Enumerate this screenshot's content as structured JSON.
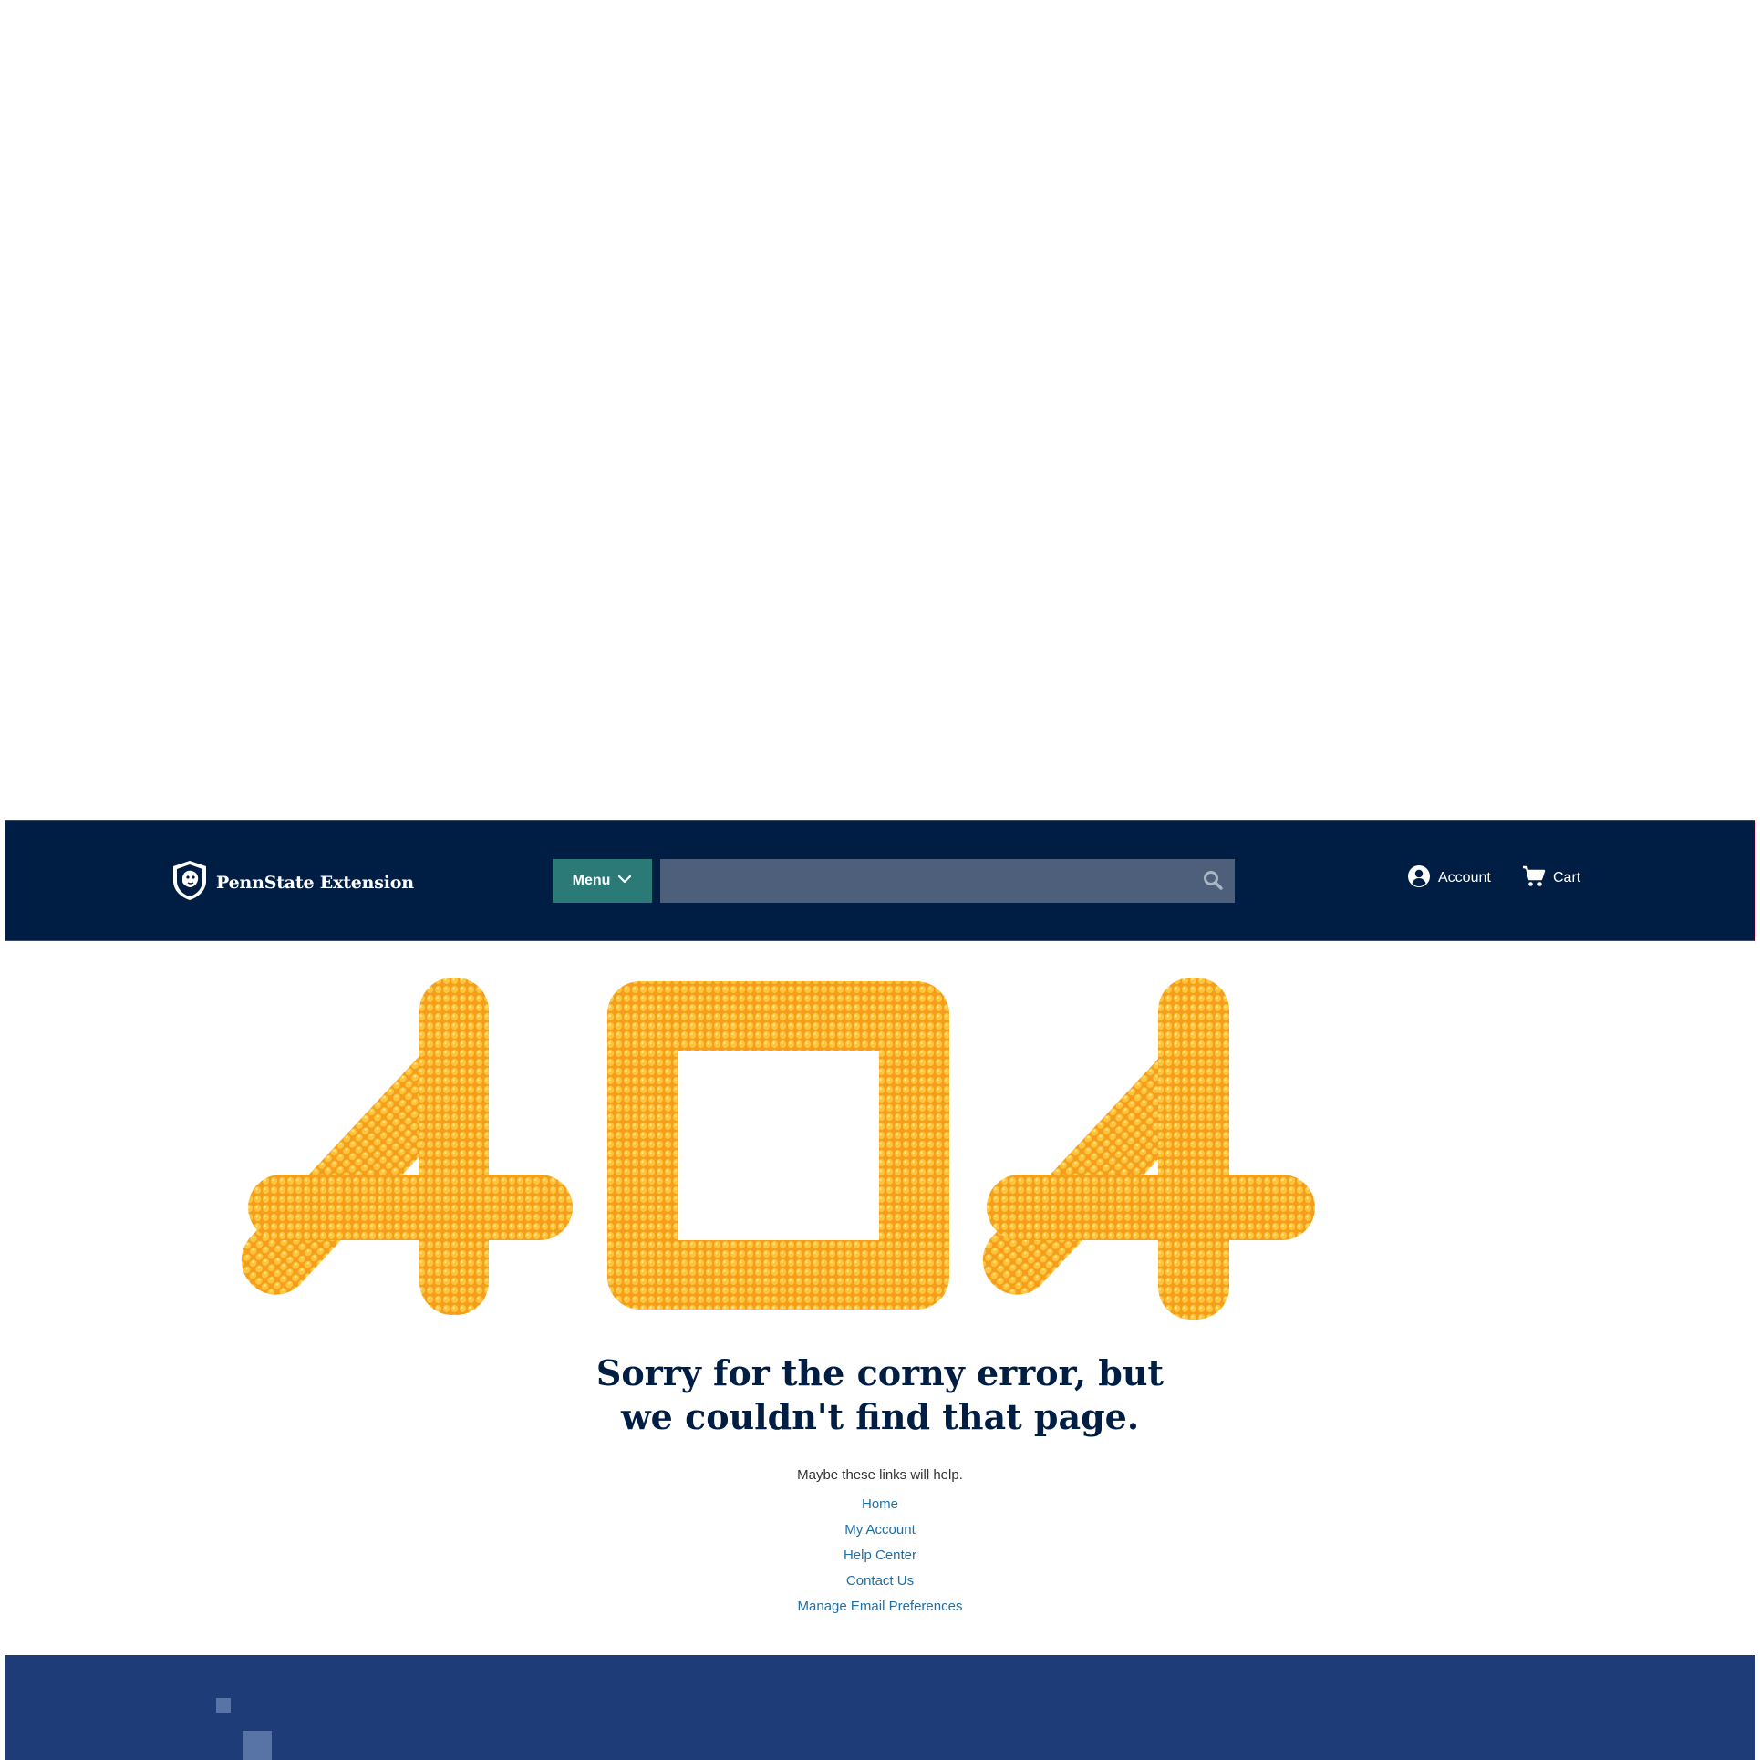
{
  "header": {
    "logo_text": "PennState Extension",
    "menu_label": "Menu",
    "search": {
      "value": "",
      "placeholder": ""
    },
    "account_label": "Account",
    "cart_label": "Cart"
  },
  "hero": {
    "image_text": "404"
  },
  "message": {
    "title_line1": "Sorry for the corny error, but",
    "title_line2": "we couldn't find that page.",
    "help_text": "Maybe these links will help."
  },
  "links": [
    {
      "label": "Home"
    },
    {
      "label": "My Account"
    },
    {
      "label": "Help Center"
    },
    {
      "label": "Contact Us"
    },
    {
      "label": "Manage Email Preferences"
    }
  ],
  "colors": {
    "header_bg": "#001e44",
    "menu_bg": "#2b7a78",
    "search_bg": "#4d5f7a",
    "link": "#1e6fa8",
    "footer_bg": "#1e3c78",
    "corn": "#f5a623"
  },
  "icons": {
    "logo": "nittany-lion-shield-icon",
    "menu": "chevron-down-icon",
    "search": "search-icon",
    "account": "user-circle-icon",
    "cart": "shopping-cart-icon"
  }
}
